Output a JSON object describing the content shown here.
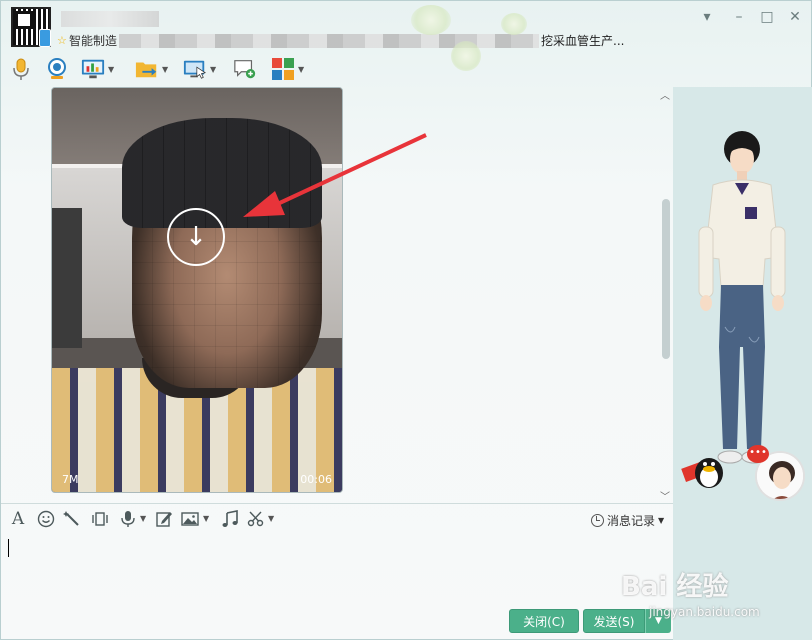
{
  "header": {
    "signature_start": "智能制造",
    "signature_end": "挖采血管生产..."
  },
  "window_controls": {
    "menu": "▾",
    "minimize": "–",
    "maximize": "□",
    "close": "✕"
  },
  "toolbar": {
    "items": [
      {
        "name": "voice-call",
        "icon": "microphone-icon"
      },
      {
        "name": "video-call",
        "icon": "webcam-icon"
      },
      {
        "name": "remote-desktop",
        "icon": "monitor-chart-icon"
      },
      {
        "name": "send-file",
        "icon": "folder-arrow-icon"
      },
      {
        "name": "screen-share",
        "icon": "screen-cursor-icon"
      },
      {
        "name": "create-discussion",
        "icon": "chat-add-icon"
      },
      {
        "name": "apps",
        "icon": "app-grid-icon"
      }
    ]
  },
  "message": {
    "video": {
      "size": "7M",
      "duration": "00:06",
      "download_symbol": "↓"
    }
  },
  "input_toolbar": {
    "font": "A",
    "history_label": "消息记录"
  },
  "buttons": {
    "close_label": "关闭(C)",
    "send_label": "发送(S)"
  },
  "watermark": {
    "text": "Bai 经验",
    "sub": "jingyan.baidu.com"
  },
  "colors": {
    "send_green": "#4bb08a",
    "arrow_red": "#e8343a"
  }
}
